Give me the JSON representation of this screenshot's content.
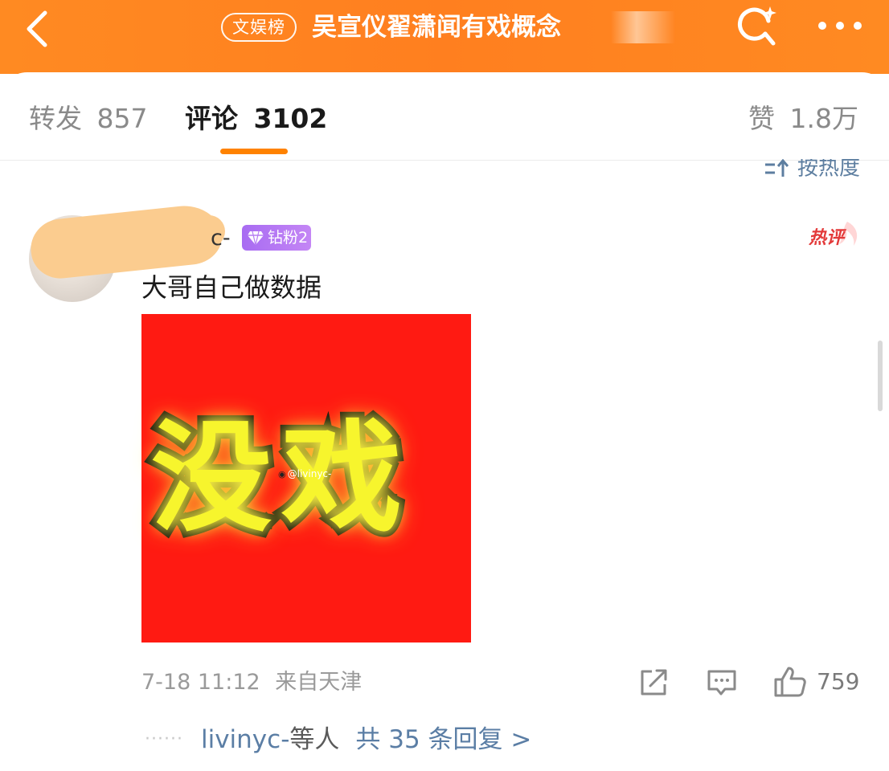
{
  "header": {
    "topic_badge": "文娱榜",
    "title": "吴宣仪翟潇闻有戏概念",
    "back_icon": "chevron-left-icon",
    "search_icon": "search-sparkle-icon",
    "more_icon": "more-dots-icon",
    "color": "#ff8420"
  },
  "tabs": {
    "reposts": {
      "label": "转发",
      "count": "857"
    },
    "comments": {
      "label": "评论",
      "count": "3102"
    },
    "likes": {
      "label": "赞",
      "count": "1.8万"
    },
    "active": "comments",
    "accent": "#ff8200"
  },
  "sort": {
    "label": "按热度"
  },
  "comment": {
    "username_tail": "c-",
    "fan_badge": "钻粉2",
    "hot_tag": "热评",
    "text": "大哥自己做数据",
    "image": {
      "caption_text": "没戏",
      "watermark": "@livinyc-",
      "background": "#ff1a12"
    },
    "timestamp": "7-18 11:12",
    "location": "来自天津",
    "like_count": "759",
    "replies": {
      "dots": "······",
      "names": "livinyc-",
      "names_suffix": "等人",
      "summary": "共 35 条回复 >"
    }
  }
}
